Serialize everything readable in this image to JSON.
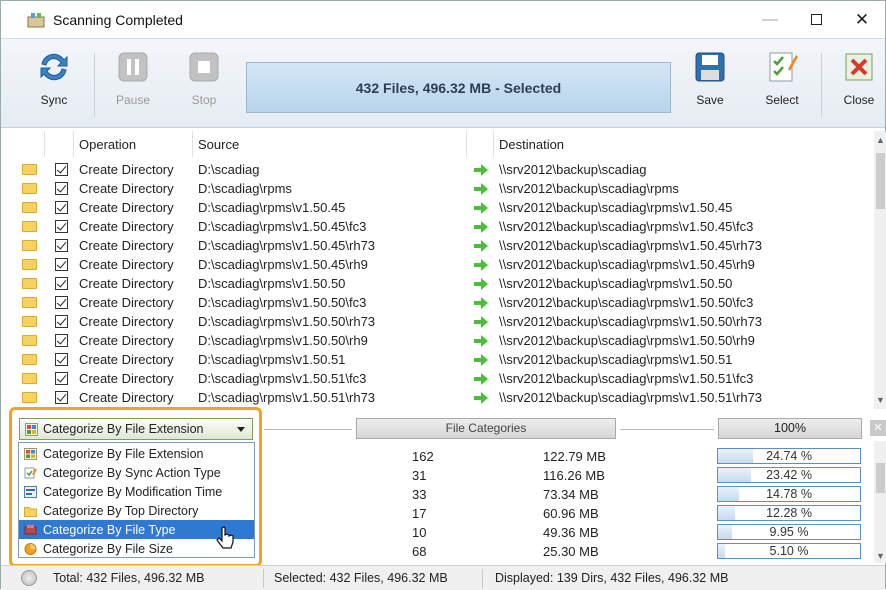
{
  "window": {
    "title": "Scanning Completed"
  },
  "toolbar": {
    "sync": "Sync",
    "pause": "Pause",
    "stop": "Stop",
    "banner": "432 Files, 496.32 MB - Selected",
    "save": "Save",
    "select": "Select",
    "close": "Close"
  },
  "grid": {
    "headers": {
      "operation": "Operation",
      "source": "Source",
      "destination": "Destination"
    },
    "rows": [
      {
        "op": "Create Directory",
        "src": "D:\\scadiag",
        "dst": "\\\\srv2012\\backup\\scadiag"
      },
      {
        "op": "Create Directory",
        "src": "D:\\scadiag\\rpms",
        "dst": "\\\\srv2012\\backup\\scadiag\\rpms"
      },
      {
        "op": "Create Directory",
        "src": "D:\\scadiag\\rpms\\v1.50.45",
        "dst": "\\\\srv2012\\backup\\scadiag\\rpms\\v1.50.45"
      },
      {
        "op": "Create Directory",
        "src": "D:\\scadiag\\rpms\\v1.50.45\\fc3",
        "dst": "\\\\srv2012\\backup\\scadiag\\rpms\\v1.50.45\\fc3"
      },
      {
        "op": "Create Directory",
        "src": "D:\\scadiag\\rpms\\v1.50.45\\rh73",
        "dst": "\\\\srv2012\\backup\\scadiag\\rpms\\v1.50.45\\rh73"
      },
      {
        "op": "Create Directory",
        "src": "D:\\scadiag\\rpms\\v1.50.45\\rh9",
        "dst": "\\\\srv2012\\backup\\scadiag\\rpms\\v1.50.45\\rh9"
      },
      {
        "op": "Create Directory",
        "src": "D:\\scadiag\\rpms\\v1.50.50",
        "dst": "\\\\srv2012\\backup\\scadiag\\rpms\\v1.50.50"
      },
      {
        "op": "Create Directory",
        "src": "D:\\scadiag\\rpms\\v1.50.50\\fc3",
        "dst": "\\\\srv2012\\backup\\scadiag\\rpms\\v1.50.50\\fc3"
      },
      {
        "op": "Create Directory",
        "src": "D:\\scadiag\\rpms\\v1.50.50\\rh73",
        "dst": "\\\\srv2012\\backup\\scadiag\\rpms\\v1.50.50\\rh73"
      },
      {
        "op": "Create Directory",
        "src": "D:\\scadiag\\rpms\\v1.50.50\\rh9",
        "dst": "\\\\srv2012\\backup\\scadiag\\rpms\\v1.50.50\\rh9"
      },
      {
        "op": "Create Directory",
        "src": "D:\\scadiag\\rpms\\v1.50.51",
        "dst": "\\\\srv2012\\backup\\scadiag\\rpms\\v1.50.51"
      },
      {
        "op": "Create Directory",
        "src": "D:\\scadiag\\rpms\\v1.50.51\\fc3",
        "dst": "\\\\srv2012\\backup\\scadiag\\rpms\\v1.50.51\\fc3"
      },
      {
        "op": "Create Directory",
        "src": "D:\\scadiag\\rpms\\v1.50.51\\rh73",
        "dst": "\\\\srv2012\\backup\\scadiag\\rpms\\v1.50.51\\rh73"
      }
    ]
  },
  "categorize": {
    "selected": "Categorize By File Extension",
    "header_button": "File Categories",
    "percent_button": "100%",
    "options": [
      "Categorize By File Extension",
      "Categorize By Sync Action Type",
      "Categorize By Modification Time",
      "Categorize By Top Directory",
      "Categorize By File Type",
      "Categorize By File Size"
    ],
    "highlighted_index": 4,
    "rows": [
      {
        "count": "162",
        "size": "122.79 MB",
        "pct": "24.74 %",
        "frac": 0.2474
      },
      {
        "count": "31",
        "size": "116.26 MB",
        "pct": "23.42 %",
        "frac": 0.2342
      },
      {
        "count": "33",
        "size": "73.34 MB",
        "pct": "14.78 %",
        "frac": 0.1478
      },
      {
        "count": "17",
        "size": "60.96 MB",
        "pct": "12.28 %",
        "frac": 0.1228
      },
      {
        "count": "10",
        "size": "49.36 MB",
        "pct": "9.95 %",
        "frac": 0.0995
      },
      {
        "count": "68",
        "size": "25.30 MB",
        "pct": "5.10 %",
        "frac": 0.051
      }
    ]
  },
  "status": {
    "total": "Total: 432 Files, 496.32 MB",
    "selected": "Selected: 432 Files, 496.32 MB",
    "displayed": "Displayed: 139 Dirs, 432 Files, 496.32 MB"
  },
  "colors": {
    "accent": "#f3a21c",
    "selection": "#3079d3",
    "banner": "#c7ddf1"
  }
}
